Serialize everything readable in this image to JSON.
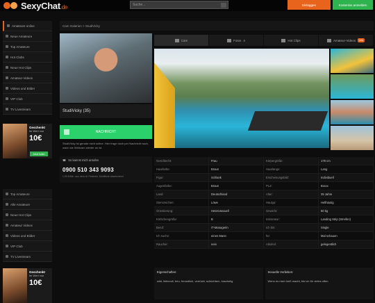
{
  "brand": {
    "name": "SexyChat",
    "tld": ".de",
    "accent": "#e8641c"
  },
  "header": {
    "search_placeholder": "Suche...",
    "login_label": "Einloggen",
    "register_label": "Kostenlos anmelden"
  },
  "sidebar_primary": [
    {
      "label": "Amateure online",
      "active": true
    },
    {
      "label": "Neue Amateure"
    },
    {
      "label": "Top Amateure"
    },
    {
      "label": "Hot Clubs"
    },
    {
      "label": "Neue Hot Clips"
    },
    {
      "label": "Amateur-Videos"
    },
    {
      "label": "Videos und Bilder"
    },
    {
      "label": "VIP Club"
    },
    {
      "label": "TV Livestream"
    }
  ],
  "promo": {
    "title": "Geschenkt",
    "sub": "im Wert von",
    "amount": "10€",
    "button": "Jetzt holen"
  },
  "sidebar_secondary": [
    {
      "label": "Top Amateure"
    },
    {
      "label": "Alle Amateure"
    },
    {
      "label": "Neue Hot Clips"
    },
    {
      "label": "Amateur Videos"
    },
    {
      "label": "Videos und Bilder"
    },
    {
      "label": "VIP Club"
    },
    {
      "label": "TV Livestream"
    }
  ],
  "breadcrumb": "Cam Galerien  >  StudiVicky",
  "profile": {
    "name": "StudiVicky (35)",
    "cta": "NACHRICHT",
    "note": "StudiVicky ist gerade nicht online. Hier frage doch per Nachricht nach, wann sie Webcam wieder an ist.",
    "phone_label": "So kannst mich anrufen",
    "phone_number": "0900 510 343 9093",
    "phone_small": "1,99 €/Min. aus dem dt. Festnetz, Mobilfunk abweichend"
  },
  "tabs": [
    {
      "label": "Cam",
      "active": true
    },
    {
      "label": "Fotos",
      "count": "4"
    },
    {
      "label": "Hot Clips"
    },
    {
      "label": "Amateur-Videos",
      "badge": "neu"
    }
  ],
  "details": [
    [
      "Geschlecht:",
      "Frau",
      "Körpergröße:",
      "178 cm"
    ],
    [
      "Haarfarbe:",
      "Braun",
      "Haarlänge:",
      "Lang"
    ],
    [
      "Figur:",
      "Schlank",
      "Erscheinungsbild:",
      "Individuell"
    ],
    [
      "Augenfarbe:",
      "Braun",
      "PLZ:",
      "8xxxx"
    ],
    [
      "Land:",
      "Deutschland",
      "Alter:",
      "35 Jahre"
    ],
    [
      "Sternzeichen:",
      "Löwe",
      "Hautyp:",
      "Hellhäutig"
    ],
    [
      "Orientierung:",
      "Heterosexuell",
      "Gewicht:",
      "60 kg"
    ],
    [
      "Körbchengröße:",
      "B",
      "Intimrasur:",
      "Landing Strip (Streifen)"
    ],
    [
      "Beruf:",
      "IT-Managerin",
      "Ich bin:",
      "Single"
    ],
    [
      "Ich suche:",
      "einen Mann",
      "für:",
      "Mal schauen"
    ],
    [
      "Raucher:",
      "nein",
      "Alkohol:",
      "gelegentlich"
    ]
  ],
  "characteristics": {
    "heading": "Eigenschaften:",
    "body": "wild, liebevoll, treu, freundlich, verrückt, schüchtern, kuschelig"
  },
  "sexual": {
    "heading": "Sexuelle Vorlieben:",
    "body": "Wenn es mich heiß macht, bin ich für vieles offen"
  }
}
